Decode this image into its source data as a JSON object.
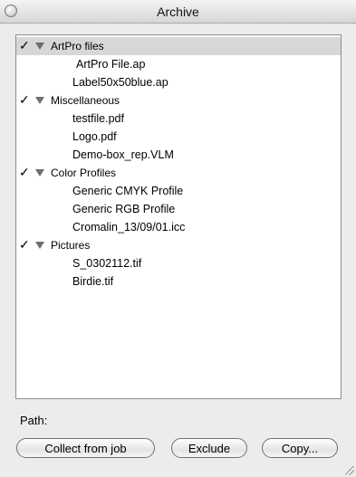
{
  "window": {
    "title": "Archive"
  },
  "groups": [
    {
      "label": "ArtPro files",
      "checked": "✓",
      "files": [
        "ArtPro File.ap",
        "Label50x50blue.ap"
      ]
    },
    {
      "label": "Miscellaneous",
      "checked": "✓",
      "files": [
        "testfile.pdf",
        "Logo.pdf",
        "Demo-box_rep.VLM"
      ]
    },
    {
      "label": "Color Profiles",
      "checked": "✓",
      "files": [
        "Generic CMYK Profile",
        "Generic RGB Profile",
        "Cromalin_13/09/01.icc"
      ]
    },
    {
      "label": "Pictures",
      "checked": "✓",
      "files": [
        "S_0302112.tif",
        "Birdie.tif"
      ]
    }
  ],
  "path_label": "Path:",
  "buttons": {
    "collect": "Collect from job",
    "exclude": "Exclude",
    "copy": "Copy..."
  },
  "icons": {
    "close": "close-icon",
    "disclosure": "triangle-down-icon",
    "check": "checkmark-icon",
    "resize": "resize-grip-icon"
  }
}
